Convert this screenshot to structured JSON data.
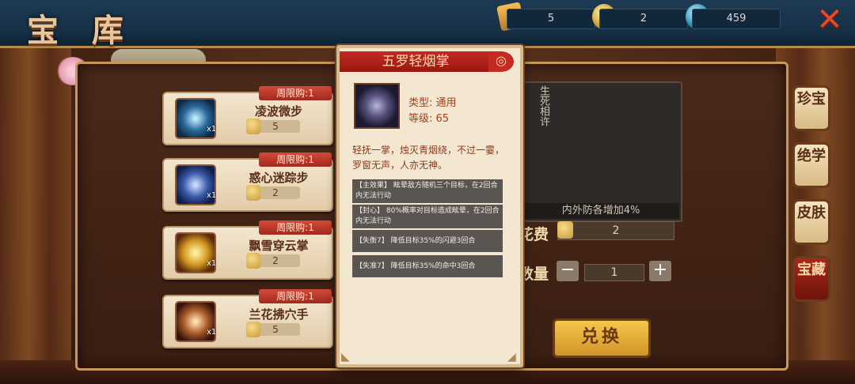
{
  "header": {
    "title": "宝 库",
    "resources": [
      {
        "icon": "scroll-icon",
        "value": "5"
      },
      {
        "icon": "coin-icon",
        "value": "2"
      },
      {
        "icon": "jade-icon",
        "value": "459"
      }
    ],
    "close_label": "✕"
  },
  "items": [
    {
      "limit": "周限购:1",
      "name": "凌波微步",
      "count": "x1",
      "price": "5",
      "icon": "skill-wave-icon"
    },
    {
      "limit": "周限购:1",
      "name": "惑心迷踪步",
      "count": "x1",
      "price": "2",
      "icon": "skill-ghost-icon"
    },
    {
      "limit": "周限购:1",
      "name": "飘雪穿云掌",
      "count": "x1",
      "price": "2",
      "icon": "skill-gold-palm-icon"
    },
    {
      "limit": "周限购:1",
      "name": "兰花拂穴手",
      "count": "x1",
      "price": "5",
      "icon": "skill-fist-icon"
    }
  ],
  "detail": {
    "vertical_name": "生死相许",
    "description": "内外防各增加4%",
    "cost_label": "花费",
    "cost_value": "2",
    "qty_label": "数量",
    "qty_minus": "−",
    "qty_plus": "+",
    "qty_value": "1",
    "exchange_label": "兑换"
  },
  "tabs": [
    {
      "label": "珍宝"
    },
    {
      "label": "绝学"
    },
    {
      "label": "皮肤"
    },
    {
      "label": "宝藏"
    }
  ],
  "popup": {
    "title": "五罗轻烟掌",
    "curl": "◎",
    "type": "类型: 通用",
    "level": "等级: 65",
    "flavor": "轻抚一掌，烛灭青烟绕，不过一霎，罗窗无声，人亦无神。",
    "effects": [
      "【主效果】 眩晕敌方随机三个目标，在2回合内无法行动",
      "【封心】 80%概率对目标造成眩晕，在2回合内无法行动",
      "【失衡7】 降低目标35%的闪避3回合",
      "【失准7】 降低目标35%的命中3回合"
    ]
  },
  "colors": {
    "accent_red": "#c22a22",
    "gold": "#d8b987",
    "button_gold": "#f4c84a"
  }
}
